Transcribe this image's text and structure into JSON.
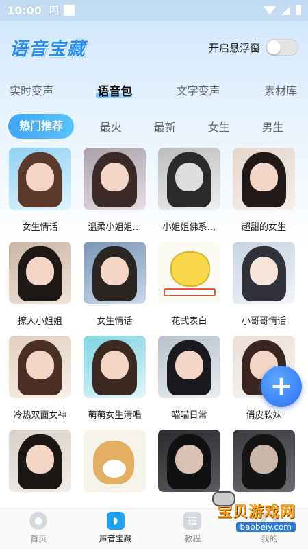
{
  "status_bar": {
    "time": "10:00"
  },
  "header": {
    "logo": "语音宝藏",
    "float_label": "开启悬浮窗"
  },
  "main_tabs": [
    {
      "label": "实时变声"
    },
    {
      "label": "语音包"
    },
    {
      "label": "文字变声"
    },
    {
      "label": "素材库"
    }
  ],
  "sub_tabs": [
    {
      "label": "热门推荐"
    },
    {
      "label": "最火"
    },
    {
      "label": "最新"
    },
    {
      "label": "女生"
    },
    {
      "label": "男生"
    }
  ],
  "grid": [
    {
      "label": "女生情话"
    },
    {
      "label": "温柔小姐姐…"
    },
    {
      "label": "小姐姐佛系…"
    },
    {
      "label": "超甜的女生"
    },
    {
      "label": "撩人小姐姐"
    },
    {
      "label": "女生情话"
    },
    {
      "label": "花式表白"
    },
    {
      "label": "小哥哥情话"
    },
    {
      "label": "冷热双面女神"
    },
    {
      "label": "萌萌女生清唱"
    },
    {
      "label": "喵喵日常"
    },
    {
      "label": "俏皮软妹"
    },
    {
      "label": ""
    },
    {
      "label": ""
    },
    {
      "label": ""
    },
    {
      "label": ""
    }
  ],
  "fab": {
    "symbol": "+"
  },
  "bottom_nav": [
    {
      "label": "首页",
      "icon": "mic-icon"
    },
    {
      "label": "声音宝藏",
      "icon": "sound-icon"
    },
    {
      "label": "教程",
      "icon": "tutorial-icon"
    },
    {
      "label": "我的",
      "icon": "profile-icon"
    }
  ],
  "watermark": {
    "title": "宝贝游戏网",
    "url": "baobeiy.com"
  },
  "colors": {
    "accent": "#3fa5f5",
    "logo": "#2a8ff0",
    "fab": "#2f6ff0"
  }
}
